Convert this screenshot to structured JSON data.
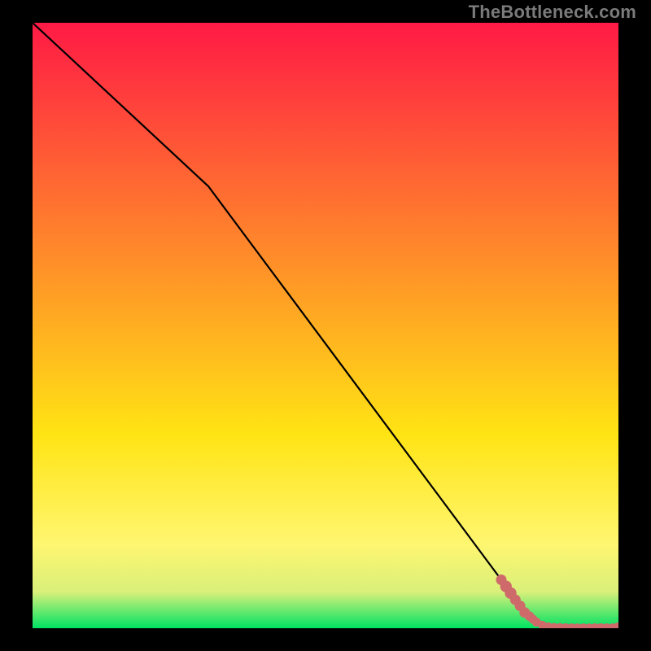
{
  "watermark": "TheBottleneck.com",
  "colors": {
    "bg": "#000000",
    "grad_top": "#ff1a45",
    "grad_mid1": "#ff8a2a",
    "grad_mid2": "#ffe414",
    "grad_mid3": "#fff670",
    "grad_mid4": "#d9f07a",
    "grad_bottom": "#00e263",
    "line": "#000000",
    "marker": "#cf6a6a"
  },
  "chart_data": {
    "type": "line",
    "title": "",
    "xlabel": "",
    "ylabel": "",
    "xlim": [
      0,
      100
    ],
    "ylim": [
      0,
      100
    ],
    "series": [
      {
        "name": "curve",
        "x": [
          0,
          5,
          10,
          15,
          20,
          25,
          30,
          35,
          40,
          45,
          50,
          55,
          60,
          65,
          70,
          75,
          80,
          84,
          86,
          88,
          90,
          92,
          94,
          96,
          98,
          100
        ],
        "y": [
          100,
          95.5,
          91,
          86.5,
          82,
          77.5,
          73,
          66.5,
          60,
          53.5,
          47,
          40.5,
          34,
          27.5,
          21,
          14.5,
          8,
          2.6,
          1.0,
          0.3,
          0.1,
          0.05,
          0.03,
          0.02,
          0.01,
          0.0
        ]
      }
    ],
    "markers": {
      "name": "highlighted-points",
      "points": [
        {
          "x": 80.0,
          "y": 8.0,
          "r": 1.0
        },
        {
          "x": 80.8,
          "y": 6.9,
          "r": 1.1
        },
        {
          "x": 81.6,
          "y": 5.8,
          "r": 1.1
        },
        {
          "x": 82.4,
          "y": 4.7,
          "r": 1.0
        },
        {
          "x": 83.2,
          "y": 3.7,
          "r": 1.0
        },
        {
          "x": 84.0,
          "y": 2.6,
          "r": 1.0
        },
        {
          "x": 84.8,
          "y": 2.0,
          "r": 0.9
        },
        {
          "x": 85.4,
          "y": 1.5,
          "r": 0.85
        },
        {
          "x": 86.0,
          "y": 1.0,
          "r": 0.85
        },
        {
          "x": 87.0,
          "y": 0.55,
          "r": 0.8
        },
        {
          "x": 88.0,
          "y": 0.3,
          "r": 0.8
        },
        {
          "x": 89.0,
          "y": 0.17,
          "r": 0.8
        },
        {
          "x": 90.0,
          "y": 0.1,
          "r": 0.85
        },
        {
          "x": 91.0,
          "y": 0.07,
          "r": 0.85
        },
        {
          "x": 92.0,
          "y": 0.05,
          "r": 0.85
        },
        {
          "x": 93.0,
          "y": 0.04,
          "r": 0.85
        },
        {
          "x": 94.0,
          "y": 0.03,
          "r": 0.85
        },
        {
          "x": 95.0,
          "y": 0.025,
          "r": 0.85
        },
        {
          "x": 96.0,
          "y": 0.02,
          "r": 0.9
        },
        {
          "x": 97.0,
          "y": 0.015,
          "r": 0.9
        },
        {
          "x": 98.0,
          "y": 0.01,
          "r": 0.9
        },
        {
          "x": 99.0,
          "y": 0.005,
          "r": 0.9
        },
        {
          "x": 100.0,
          "y": 0.0,
          "r": 1.1
        }
      ]
    }
  }
}
